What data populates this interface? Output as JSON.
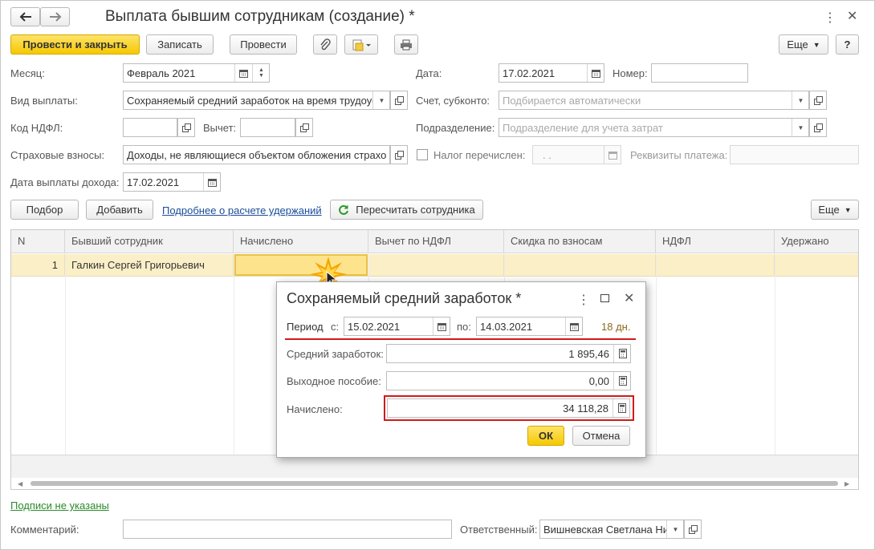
{
  "window": {
    "title": "Выплата бывшим сотрудникам (создание) *",
    "nav_back_icon": "arrow-left-icon",
    "nav_forward_icon": "arrow-right-icon"
  },
  "toolbar": {
    "post_close": "Провести и закрыть",
    "save": "Записать",
    "post": "Провести",
    "more": "Еще",
    "help": "?"
  },
  "form": {
    "month_label": "Месяц:",
    "month_value": "Февраль 2021",
    "date_label": "Дата:",
    "date_value": "17.02.2021",
    "number_label": "Номер:",
    "number_value": "",
    "pay_type_label": "Вид выплаты:",
    "pay_type_value": "Сохраняемый средний заработок на время трудоус",
    "account_label": "Счет, субконто:",
    "account_placeholder": "Подбирается автоматически",
    "ndfl_code_label": "Код НДФЛ:",
    "ndfl_code_value": "",
    "deduction_label": "Вычет:",
    "deduction_value": "",
    "division_label": "Подразделение:",
    "division_placeholder": "Подразделение для учета затрат",
    "insurance_label": "Страховые взносы:",
    "insurance_value": "Доходы, не являющиеся объектом обложения страхов",
    "tax_paid_label": "Налог перечислен:",
    "tax_paid_date": " .  .",
    "payment_details_label": "Реквизиты платежа:",
    "income_date_label": "Дата выплаты дохода:",
    "income_date_value": "17.02.2021"
  },
  "table_toolbar": {
    "select": "Подбор",
    "add": "Добавить",
    "details_link": "Подробнее о расчете удержаний",
    "recalc": "Пересчитать сотрудника",
    "more": "Еще"
  },
  "table": {
    "columns": [
      "N",
      "Бывший сотрудник",
      "Начислено",
      "Вычет по НДФЛ",
      "Скидка по взносам",
      "НДФЛ",
      "Удержано"
    ],
    "rows": [
      {
        "n": "1",
        "employee": "Галкин Сергей Григорьевич",
        "accrued": "",
        "deduction": "",
        "discount": "",
        "ndfl": "",
        "withheld": ""
      }
    ]
  },
  "dialog": {
    "title": "Сохраняемый средний заработок *",
    "period_label": "Период",
    "from_label": "с:",
    "from_value": "15.02.2021",
    "to_label": "по:",
    "to_value": "14.03.2021",
    "days": "18 дн.",
    "avg_label": "Средний заработок:",
    "avg_value": "1 895,46",
    "severance_label": "Выходное пособие:",
    "severance_value": "0,00",
    "accrued_label": "Начислено:",
    "accrued_value": "34 118,28",
    "ok": "ОК",
    "cancel": "Отмена"
  },
  "footer": {
    "signatures_link": "Подписи не указаны",
    "comment_label": "Комментарий:",
    "comment_value": "",
    "responsible_label": "Ответственный:",
    "responsible_value": "Вишневская Светлана Ни"
  },
  "colors": {
    "primary_button": "#f5c800",
    "selected_row": "#fbefc8",
    "highlight_red": "#d11a1a",
    "link": "#1a4d9a",
    "signature_link": "#2a8a2a"
  }
}
